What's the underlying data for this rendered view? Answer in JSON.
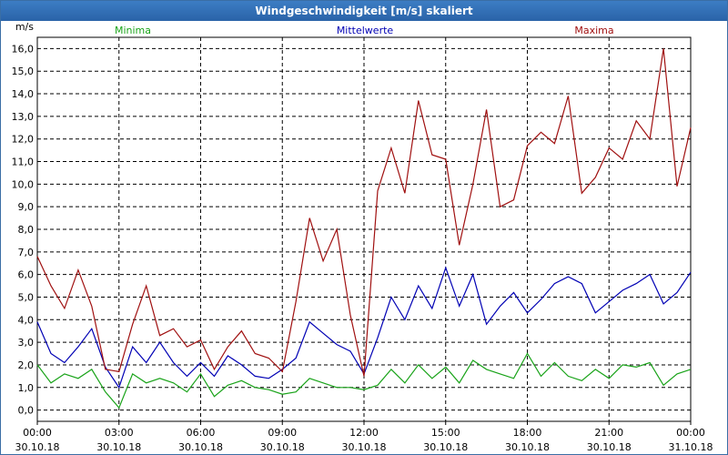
{
  "window": {
    "title": "Windgeschwindigkeit [m/s] skaliert"
  },
  "colors": {
    "min": "#19a319",
    "mean": "#0000b4",
    "max": "#a01010",
    "title_bar": "#2f6db3"
  },
  "chart_data": {
    "type": "line",
    "title": "Windgeschwindigkeit [m/s] skaliert",
    "ylabel": "m/s",
    "ylim": [
      -0.5,
      16.5
    ],
    "y_ticks": [
      "0,0",
      "1,0",
      "2,0",
      "3,0",
      "4,0",
      "5,0",
      "6,0",
      "7,0",
      "8,0",
      "9,0",
      "10,0",
      "11,0",
      "12,0",
      "13,0",
      "14,0",
      "15,0",
      "16,0"
    ],
    "xlim": [
      0,
      24
    ],
    "x_ticks": [
      {
        "time": "00:00",
        "date": "30.10.18"
      },
      {
        "time": "03:00",
        "date": "30.10.18"
      },
      {
        "time": "06:00",
        "date": "30.10.18"
      },
      {
        "time": "09:00",
        "date": "30.10.18"
      },
      {
        "time": "12:00",
        "date": "30.10.18"
      },
      {
        "time": "15:00",
        "date": "30.10.18"
      },
      {
        "time": "18:00",
        "date": "30.10.18"
      },
      {
        "time": "21:00",
        "date": "30.10.18"
      },
      {
        "time": "00:00",
        "date": "31.10.18"
      }
    ],
    "grid": true,
    "legend_position": "top",
    "series": [
      {
        "name": "Minima",
        "x": [
          0,
          0.5,
          1,
          1.5,
          2,
          2.5,
          3,
          3.5,
          4,
          4.5,
          5,
          5.5,
          6,
          6.5,
          7,
          7.5,
          8,
          8.5,
          9,
          9.5,
          10,
          10.5,
          11,
          11.5,
          12,
          12.5,
          13,
          13.5,
          14,
          14.5,
          15,
          15.5,
          16,
          16.5,
          17,
          17.5,
          18,
          18.5,
          19,
          19.5,
          20,
          20.5,
          21,
          21.5,
          22,
          22.5,
          23,
          23.5,
          24
        ],
        "values": [
          2.0,
          1.2,
          1.6,
          1.4,
          1.8,
          0.8,
          0.1,
          1.6,
          1.2,
          1.4,
          1.2,
          0.8,
          1.6,
          0.6,
          1.1,
          1.3,
          1.0,
          0.9,
          0.7,
          0.8,
          1.4,
          1.2,
          1.0,
          1.0,
          0.9,
          1.1,
          1.8,
          1.2,
          2.0,
          1.4,
          1.9,
          1.2,
          2.2,
          1.8,
          1.6,
          1.4,
          2.5,
          1.5,
          2.1,
          1.5,
          1.3,
          1.8,
          1.4,
          2.0,
          1.9,
          2.1,
          1.1,
          1.6,
          1.8
        ]
      },
      {
        "name": "Mittelwerte",
        "x": [
          0,
          0.5,
          1,
          1.5,
          2,
          2.5,
          3,
          3.5,
          4,
          4.5,
          5,
          5.5,
          6,
          6.5,
          7,
          7.5,
          8,
          8.5,
          9,
          9.5,
          10,
          10.5,
          11,
          11.5,
          12,
          12.5,
          13,
          13.5,
          14,
          14.5,
          15,
          15.5,
          16,
          16.5,
          17,
          17.5,
          18,
          18.5,
          19,
          19.5,
          20,
          20.5,
          21,
          21.5,
          22,
          22.5,
          23,
          23.5,
          24
        ],
        "values": [
          3.9,
          2.5,
          2.1,
          2.8,
          3.6,
          1.9,
          1.0,
          2.8,
          2.1,
          3.0,
          2.1,
          1.5,
          2.1,
          1.5,
          2.4,
          2.0,
          1.5,
          1.4,
          1.8,
          2.3,
          3.9,
          3.4,
          2.9,
          2.6,
          1.6,
          3.2,
          5.0,
          4.0,
          5.5,
          4.5,
          6.3,
          4.6,
          6.0,
          3.8,
          4.6,
          5.2,
          4.3,
          4.9,
          5.6,
          5.9,
          5.6,
          4.3,
          4.8,
          5.3,
          5.6,
          6.0,
          4.7,
          5.2,
          6.1
        ]
      },
      {
        "name": "Maxima",
        "x": [
          0,
          0.5,
          1,
          1.5,
          2,
          2.5,
          3,
          3.5,
          4,
          4.5,
          5,
          5.5,
          6,
          6.5,
          7,
          7.5,
          8,
          8.5,
          9,
          9.5,
          10,
          10.5,
          11,
          11.5,
          12,
          12.5,
          13,
          13.5,
          14,
          14.5,
          15,
          15.5,
          16,
          16.5,
          17,
          17.5,
          18,
          18.5,
          19,
          19.5,
          20,
          20.5,
          21,
          21.5,
          22,
          22.5,
          23,
          23.5,
          24
        ],
        "values": [
          6.8,
          5.5,
          4.5,
          6.2,
          4.6,
          1.8,
          1.7,
          3.8,
          5.5,
          3.3,
          3.6,
          2.8,
          3.1,
          1.8,
          2.8,
          3.5,
          2.5,
          2.3,
          1.7,
          4.8,
          8.5,
          6.6,
          8.0,
          4.2,
          1.5,
          9.7,
          11.6,
          9.6,
          13.7,
          11.3,
          11.1,
          7.3,
          10.0,
          13.3,
          9.0,
          9.3,
          11.7,
          12.3,
          11.8,
          13.9,
          9.6,
          10.3,
          11.6,
          11.1,
          12.8,
          12.0,
          16.0,
          9.9,
          12.5
        ]
      }
    ]
  }
}
